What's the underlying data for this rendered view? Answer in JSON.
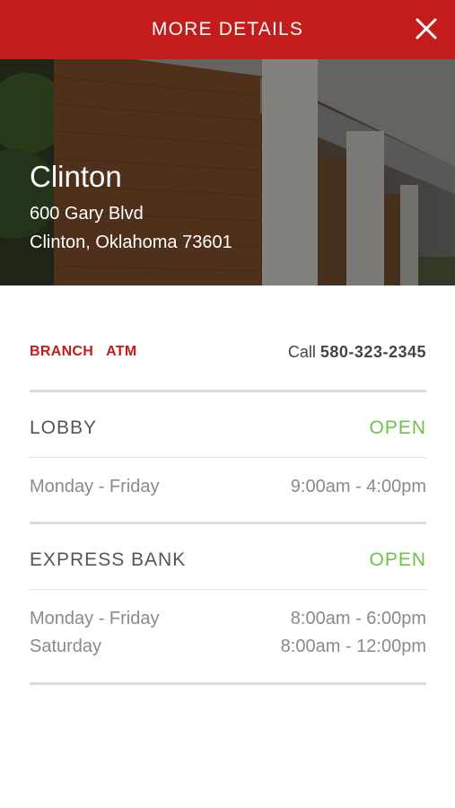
{
  "header": {
    "title": "MORE DETAILS",
    "close_icon": "close-icon"
  },
  "location": {
    "city": "Clinton",
    "address_line1": "600 Gary Blvd",
    "address_line2": "Clinton, Oklahoma 73601"
  },
  "tags": [
    "BRANCH",
    "ATM"
  ],
  "contact": {
    "call_prefix": "Call",
    "phone": "580-323-2345"
  },
  "sections": [
    {
      "title": "LOBBY",
      "status": "OPEN",
      "hours": [
        {
          "days": "Monday - Friday",
          "time": "9:00am - 4:00pm"
        }
      ]
    },
    {
      "title": "EXPRESS BANK",
      "status": "OPEN",
      "hours": [
        {
          "days": "Monday - Friday",
          "time": "8:00am - 6:00pm"
        },
        {
          "days": "Saturday",
          "time": "8:00am - 12:00pm"
        }
      ]
    }
  ],
  "colors": {
    "brand_red": "#c41b1b",
    "open_green": "#6cc24a"
  }
}
